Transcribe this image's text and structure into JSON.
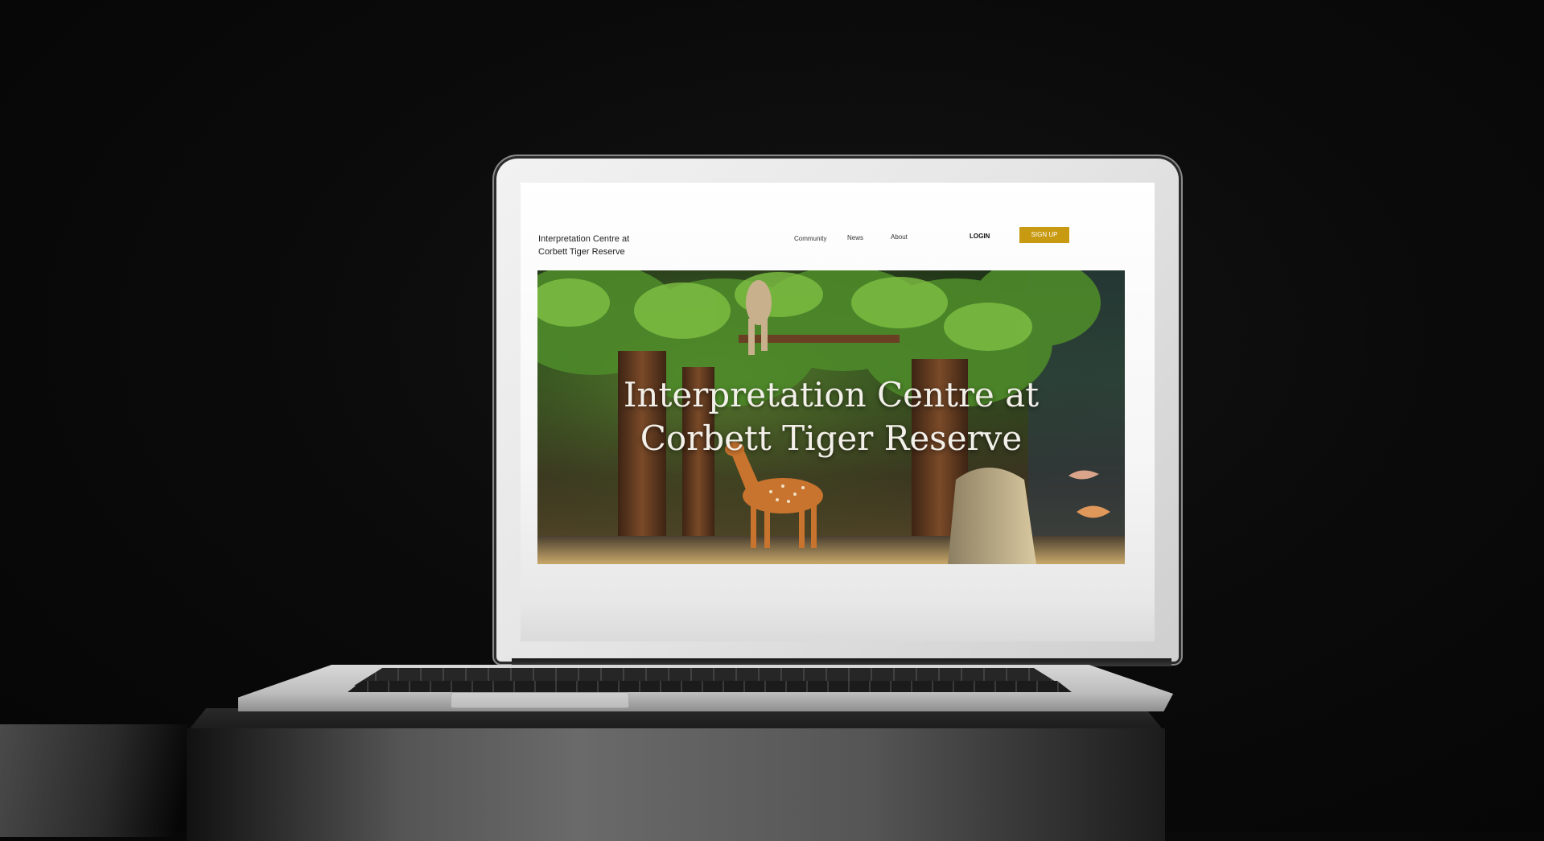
{
  "site": {
    "brand_line1": "Interpretation Centre at",
    "brand_line2": "Corbett Tiger Reserve"
  },
  "nav": {
    "items": [
      {
        "label": "Community"
      },
      {
        "label": "News"
      },
      {
        "label": "About"
      }
    ],
    "login_label": "LOGIN",
    "signup_label": "SIGN UP"
  },
  "hero": {
    "title_line1": "Interpretation Centre at",
    "title_line2": "Corbett Tiger Reserve"
  },
  "colors": {
    "accent": "#c79a12",
    "background": "#0b0b0b",
    "page": "#ffffff"
  },
  "icons": {
    "camera": "camera-icon"
  }
}
